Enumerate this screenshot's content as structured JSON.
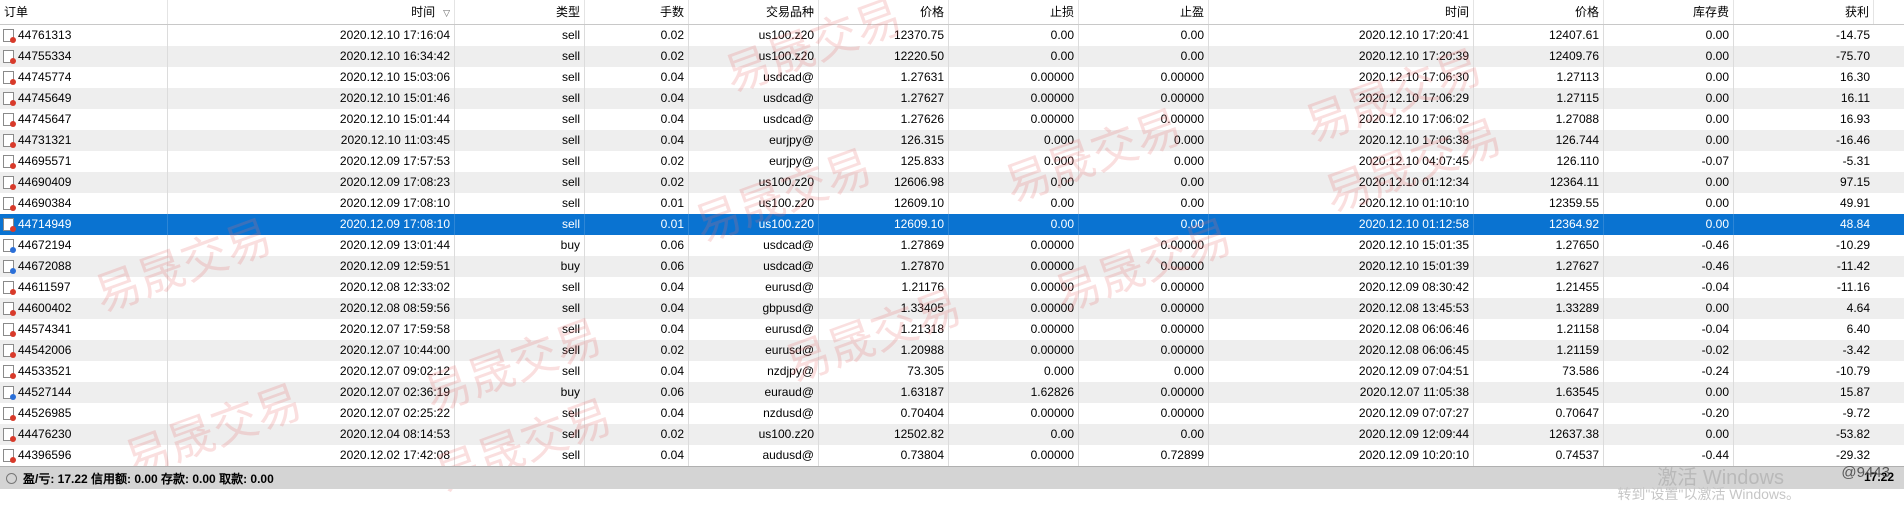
{
  "columns": [
    "订单",
    "时间",
    "类型",
    "手数",
    "交易品种",
    "价格",
    "止损",
    "止盈",
    "时间",
    "价格",
    "库存费",
    "获利"
  ],
  "rows": [
    {
      "order": "44761313",
      "open_time": "2020.12.10 17:16:04",
      "type": "sell",
      "lots": "0.02",
      "symbol": "us100.z20",
      "open_price": "12370.75",
      "sl": "0.00",
      "tp": "0.00",
      "close_time": "2020.12.10 17:20:41",
      "close_price": "12407.61",
      "swap": "0.00",
      "profit": "-14.75"
    },
    {
      "order": "44755334",
      "open_time": "2020.12.10 16:34:42",
      "type": "sell",
      "lots": "0.02",
      "symbol": "us100.z20",
      "open_price": "12220.50",
      "sl": "0.00",
      "tp": "0.00",
      "close_time": "2020.12.10 17:20:39",
      "close_price": "12409.76",
      "swap": "0.00",
      "profit": "-75.70"
    },
    {
      "order": "44745774",
      "open_time": "2020.12.10 15:03:06",
      "type": "sell",
      "lots": "0.04",
      "symbol": "usdcad@",
      "open_price": "1.27631",
      "sl": "0.00000",
      "tp": "0.00000",
      "close_time": "2020.12.10 17:06:30",
      "close_price": "1.27113",
      "swap": "0.00",
      "profit": "16.30"
    },
    {
      "order": "44745649",
      "open_time": "2020.12.10 15:01:46",
      "type": "sell",
      "lots": "0.04",
      "symbol": "usdcad@",
      "open_price": "1.27627",
      "sl": "0.00000",
      "tp": "0.00000",
      "close_time": "2020.12.10 17:06:29",
      "close_price": "1.27115",
      "swap": "0.00",
      "profit": "16.11"
    },
    {
      "order": "44745647",
      "open_time": "2020.12.10 15:01:44",
      "type": "sell",
      "lots": "0.04",
      "symbol": "usdcad@",
      "open_price": "1.27626",
      "sl": "0.00000",
      "tp": "0.00000",
      "close_time": "2020.12.10 17:06:02",
      "close_price": "1.27088",
      "swap": "0.00",
      "profit": "16.93"
    },
    {
      "order": "44731321",
      "open_time": "2020.12.10 11:03:45",
      "type": "sell",
      "lots": "0.04",
      "symbol": "eurjpy@",
      "open_price": "126.315",
      "sl": "0.000",
      "tp": "0.000",
      "close_time": "2020.12.10 17:06:38",
      "close_price": "126.744",
      "swap": "0.00",
      "profit": "-16.46"
    },
    {
      "order": "44695571",
      "open_time": "2020.12.09 17:57:53",
      "type": "sell",
      "lots": "0.02",
      "symbol": "eurjpy@",
      "open_price": "125.833",
      "sl": "0.000",
      "tp": "0.000",
      "close_time": "2020.12.10 04:07:45",
      "close_price": "126.110",
      "swap": "-0.07",
      "profit": "-5.31"
    },
    {
      "order": "44690409",
      "open_time": "2020.12.09 17:08:23",
      "type": "sell",
      "lots": "0.02",
      "symbol": "us100.z20",
      "open_price": "12606.98",
      "sl": "0.00",
      "tp": "0.00",
      "close_time": "2020.12.10 01:12:34",
      "close_price": "12364.11",
      "swap": "0.00",
      "profit": "97.15"
    },
    {
      "order": "44690384",
      "open_time": "2020.12.09 17:08:10",
      "type": "sell",
      "lots": "0.01",
      "symbol": "us100.z20",
      "open_price": "12609.10",
      "sl": "0.00",
      "tp": "0.00",
      "close_time": "2020.12.10 01:10:10",
      "close_price": "12359.55",
      "swap": "0.00",
      "profit": "49.91"
    },
    {
      "order": "44714949",
      "open_time": "2020.12.09 17:08:10",
      "type": "sell",
      "lots": "0.01",
      "symbol": "us100.z20",
      "open_price": "12609.10",
      "sl": "0.00",
      "tp": "0.00",
      "close_time": "2020.12.10 01:12:58",
      "close_price": "12364.92",
      "swap": "0.00",
      "profit": "48.84"
    },
    {
      "order": "44672194",
      "open_time": "2020.12.09 13:01:44",
      "type": "buy",
      "lots": "0.06",
      "symbol": "usdcad@",
      "open_price": "1.27869",
      "sl": "0.00000",
      "tp": "0.00000",
      "close_time": "2020.12.10 15:01:35",
      "close_price": "1.27650",
      "swap": "-0.46",
      "profit": "-10.29"
    },
    {
      "order": "44672088",
      "open_time": "2020.12.09 12:59:51",
      "type": "buy",
      "lots": "0.06",
      "symbol": "usdcad@",
      "open_price": "1.27870",
      "sl": "0.00000",
      "tp": "0.00000",
      "close_time": "2020.12.10 15:01:39",
      "close_price": "1.27627",
      "swap": "-0.46",
      "profit": "-11.42"
    },
    {
      "order": "44611597",
      "open_time": "2020.12.08 12:33:02",
      "type": "sell",
      "lots": "0.04",
      "symbol": "eurusd@",
      "open_price": "1.21176",
      "sl": "0.00000",
      "tp": "0.00000",
      "close_time": "2020.12.09 08:30:42",
      "close_price": "1.21455",
      "swap": "-0.04",
      "profit": "-11.16"
    },
    {
      "order": "44600402",
      "open_time": "2020.12.08 08:59:56",
      "type": "sell",
      "lots": "0.04",
      "symbol": "gbpusd@",
      "open_price": "1.33405",
      "sl": "0.00000",
      "tp": "0.00000",
      "close_time": "2020.12.08 13:45:53",
      "close_price": "1.33289",
      "swap": "0.00",
      "profit": "4.64"
    },
    {
      "order": "44574341",
      "open_time": "2020.12.07 17:59:58",
      "type": "sell",
      "lots": "0.04",
      "symbol": "eurusd@",
      "open_price": "1.21318",
      "sl": "0.00000",
      "tp": "0.00000",
      "close_time": "2020.12.08 06:06:46",
      "close_price": "1.21158",
      "swap": "-0.04",
      "profit": "6.40"
    },
    {
      "order": "44542006",
      "open_time": "2020.12.07 10:44:00",
      "type": "sell",
      "lots": "0.02",
      "symbol": "eurusd@",
      "open_price": "1.20988",
      "sl": "0.00000",
      "tp": "0.00000",
      "close_time": "2020.12.08 06:06:45",
      "close_price": "1.21159",
      "swap": "-0.02",
      "profit": "-3.42"
    },
    {
      "order": "44533521",
      "open_time": "2020.12.07 09:02:12",
      "type": "sell",
      "lots": "0.04",
      "symbol": "nzdjpy@",
      "open_price": "73.305",
      "sl": "0.000",
      "tp": "0.000",
      "close_time": "2020.12.09 07:04:51",
      "close_price": "73.586",
      "swap": "-0.24",
      "profit": "-10.79"
    },
    {
      "order": "44527144",
      "open_time": "2020.12.07 02:36:19",
      "type": "buy",
      "lots": "0.06",
      "symbol": "euraud@",
      "open_price": "1.63187",
      "sl": "1.62826",
      "tp": "0.00000",
      "close_time": "2020.12.07 11:05:38",
      "close_price": "1.63545",
      "swap": "0.00",
      "profit": "15.87"
    },
    {
      "order": "44526985",
      "open_time": "2020.12.07 02:25:22",
      "type": "sell",
      "lots": "0.04",
      "symbol": "nzdusd@",
      "open_price": "0.70404",
      "sl": "0.00000",
      "tp": "0.00000",
      "close_time": "2020.12.09 07:07:27",
      "close_price": "0.70647",
      "swap": "-0.20",
      "profit": "-9.72"
    },
    {
      "order": "44476230",
      "open_time": "2020.12.04 08:14:53",
      "type": "sell",
      "lots": "0.02",
      "symbol": "us100.z20",
      "open_price": "12502.82",
      "sl": "0.00",
      "tp": "0.00",
      "close_time": "2020.12.09 12:09:44",
      "close_price": "12637.38",
      "swap": "0.00",
      "profit": "-53.82"
    },
    {
      "order": "44396596",
      "open_time": "2020.12.02 17:42:08",
      "type": "sell",
      "lots": "0.04",
      "symbol": "audusd@",
      "open_price": "0.73804",
      "sl": "0.00000",
      "tp": "0.72899",
      "close_time": "2020.12.09 10:20:10",
      "close_price": "0.74537",
      "swap": "-0.44",
      "profit": "-29.32"
    }
  ],
  "selected_row": 9,
  "footer": {
    "summary": "盈/亏: 17.22  信用额: 0.00  存款: 0.00  取款: 0.00",
    "total": "17.22"
  },
  "watermark": "易晟交易",
  "overlay": {
    "activation_line1": "激活 Windows",
    "activation_line2": "转到\"设置\"以激活 Windows。",
    "brand": "@9443"
  },
  "colors": {
    "selected_row": "#0a73d1",
    "alt_row": "#eeeeee",
    "footer": "#d4d4d4",
    "watermark": "#e66e6e"
  },
  "icons": {
    "sell": "order-sell-icon",
    "buy": "order-buy-icon"
  }
}
